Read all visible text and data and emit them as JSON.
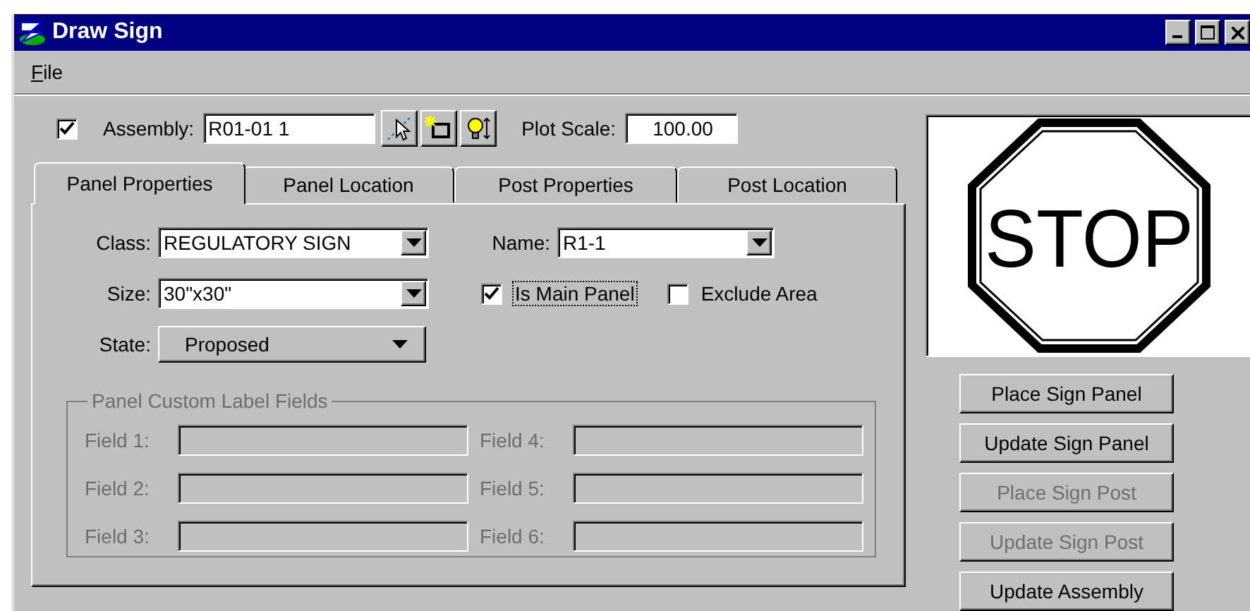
{
  "window": {
    "title": "Draw Sign"
  },
  "menu": [
    {
      "label": "File"
    }
  ],
  "assembly": {
    "checked": true,
    "label": "Assembly:",
    "value": "R01-01 1"
  },
  "plot_scale": {
    "label": "Plot Scale:",
    "value": "100.00"
  },
  "tabs": [
    {
      "label": "Panel Properties",
      "selected": true
    },
    {
      "label": "Panel Location",
      "selected": false
    },
    {
      "label": "Post Properties",
      "selected": false
    },
    {
      "label": "Post Location",
      "selected": false
    }
  ],
  "class_field": {
    "label": "Class:",
    "value": "REGULATORY SIGN",
    "kind": "combo"
  },
  "name_field": {
    "label": "Name:",
    "value": "R1-1",
    "kind": "combo"
  },
  "size_field": {
    "label": "Size:",
    "value": "30\"x30\"",
    "kind": "combo"
  },
  "state_field": {
    "label": "State:",
    "value": "Proposed",
    "kind": "dropdown"
  },
  "checkboxes": [
    {
      "label": "Is Main Panel",
      "checked": true,
      "focused": true
    },
    {
      "label": "Exclude Area",
      "checked": false,
      "focused": false
    }
  ],
  "custom_labels": {
    "title": "Panel Custom Label Fields",
    "disabled": true,
    "fields": [
      {
        "label": "Field 1:"
      },
      {
        "label": "Field 2:"
      },
      {
        "label": "Field 3:"
      },
      {
        "label": "Field 4:"
      },
      {
        "label": "Field 5:"
      },
      {
        "label": "Field 6:"
      }
    ]
  },
  "preview": {
    "sign_text": "STOP"
  },
  "buttons": [
    {
      "label": "Place Sign Panel",
      "disabled": false
    },
    {
      "label": "Update Sign Panel",
      "disabled": false
    },
    {
      "label": "Place Sign Post",
      "disabled": true
    },
    {
      "label": "Update Sign Post",
      "disabled": true
    },
    {
      "label": "Update Assembly",
      "disabled": false
    }
  ]
}
